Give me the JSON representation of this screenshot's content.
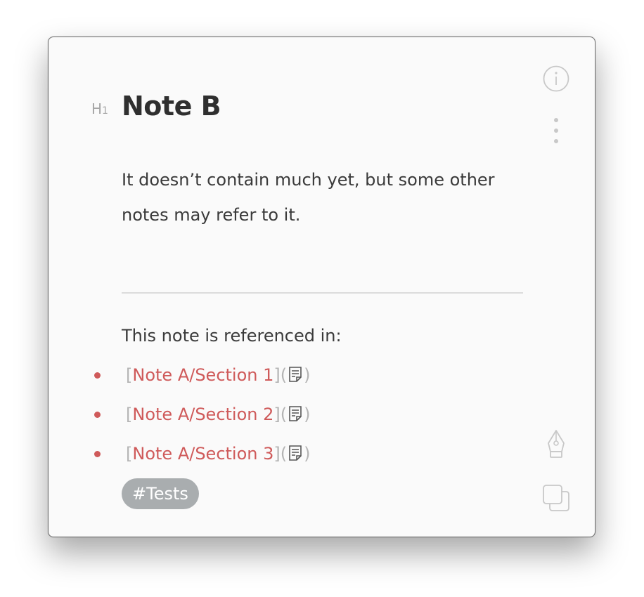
{
  "note": {
    "heading_marker": "H",
    "heading_marker_level": "1",
    "title": "Note B",
    "body": "It doesn’t contain much yet, but some other notes may refer to it."
  },
  "references": {
    "heading": "This note is referenced in:",
    "items": [
      {
        "open_bracket": "[",
        "label": "Note A/Section 1",
        "close_bracket": "](",
        "close_paren": ")",
        "icon": "document-icon"
      },
      {
        "open_bracket": "[",
        "label": "Note A/Section 2",
        "close_bracket": "](",
        "close_paren": ")",
        "icon": "document-icon"
      },
      {
        "open_bracket": "[",
        "label": "Note A/Section 3",
        "close_bracket": "](",
        "close_paren": ")",
        "icon": "document-icon"
      }
    ]
  },
  "tags": [
    "#Tests"
  ],
  "toolbar": {
    "icons": [
      "info-icon",
      "more-vertical-icon",
      "pen-nib-icon",
      "duplicate-window-icon"
    ]
  },
  "colors": {
    "accent": "#cf5a5a",
    "tag_background": "#a9adaf",
    "text": "#3a3a3a",
    "muted": "#b4b4b4",
    "window_background": "#fafafa"
  }
}
